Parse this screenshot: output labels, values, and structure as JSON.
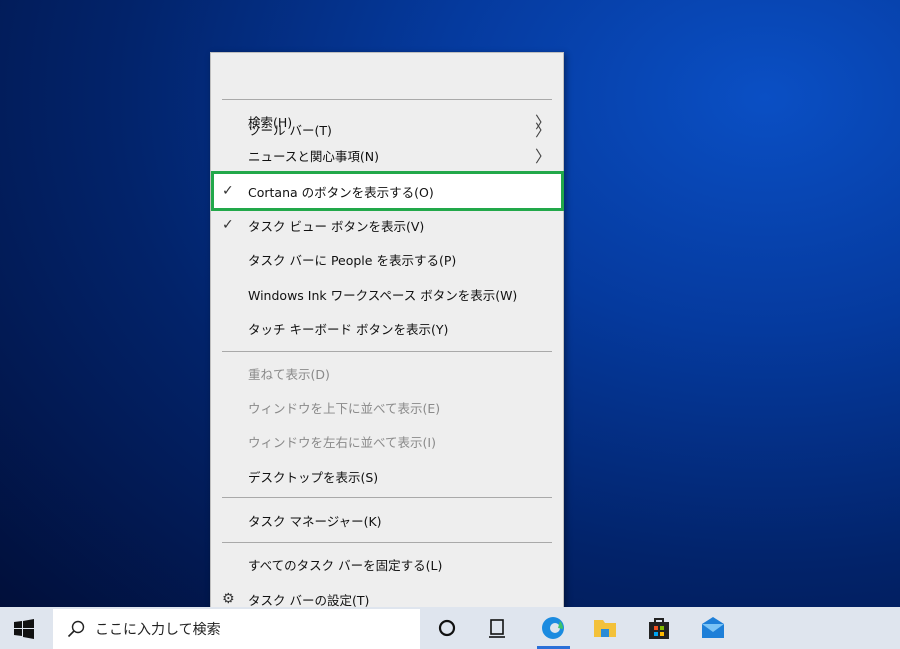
{
  "menu": {
    "items": [
      {
        "label": "ツール バー(T)",
        "submenu": true
      },
      {
        "label": "検索(H)",
        "submenu": true
      },
      {
        "label": "ニュースと関心事項(N)",
        "submenu": true
      },
      {
        "label": "Cortana のボタンを表示する(O)",
        "checked": true
      },
      {
        "label": "タスク ビュー ボタンを表示(V)",
        "checked": true
      },
      {
        "label": "タスク バーに People を表示する(P)"
      },
      {
        "label": "Windows Ink ワークスペース ボタンを表示(W)"
      },
      {
        "label": "タッチ キーボード ボタンを表示(Y)"
      },
      {
        "label": "重ねて表示(D)",
        "disabled": true
      },
      {
        "label": "ウィンドウを上下に並べて表示(E)",
        "disabled": true
      },
      {
        "label": "ウィンドウを左右に並べて表示(I)",
        "disabled": true
      },
      {
        "label": "デスクトップを表示(S)"
      },
      {
        "label": "タスク マネージャー(K)"
      },
      {
        "label": "すべてのタスク バーを固定する(L)"
      },
      {
        "label": "タスク バーの設定(T)",
        "icon": "gear-icon"
      }
    ],
    "check_glyph": "✓",
    "chevron_glyph": "〉",
    "gear_glyph": "⚙",
    "highlight_color": "#22a84a"
  },
  "taskbar": {
    "search_placeholder": "ここに入力して検索"
  }
}
